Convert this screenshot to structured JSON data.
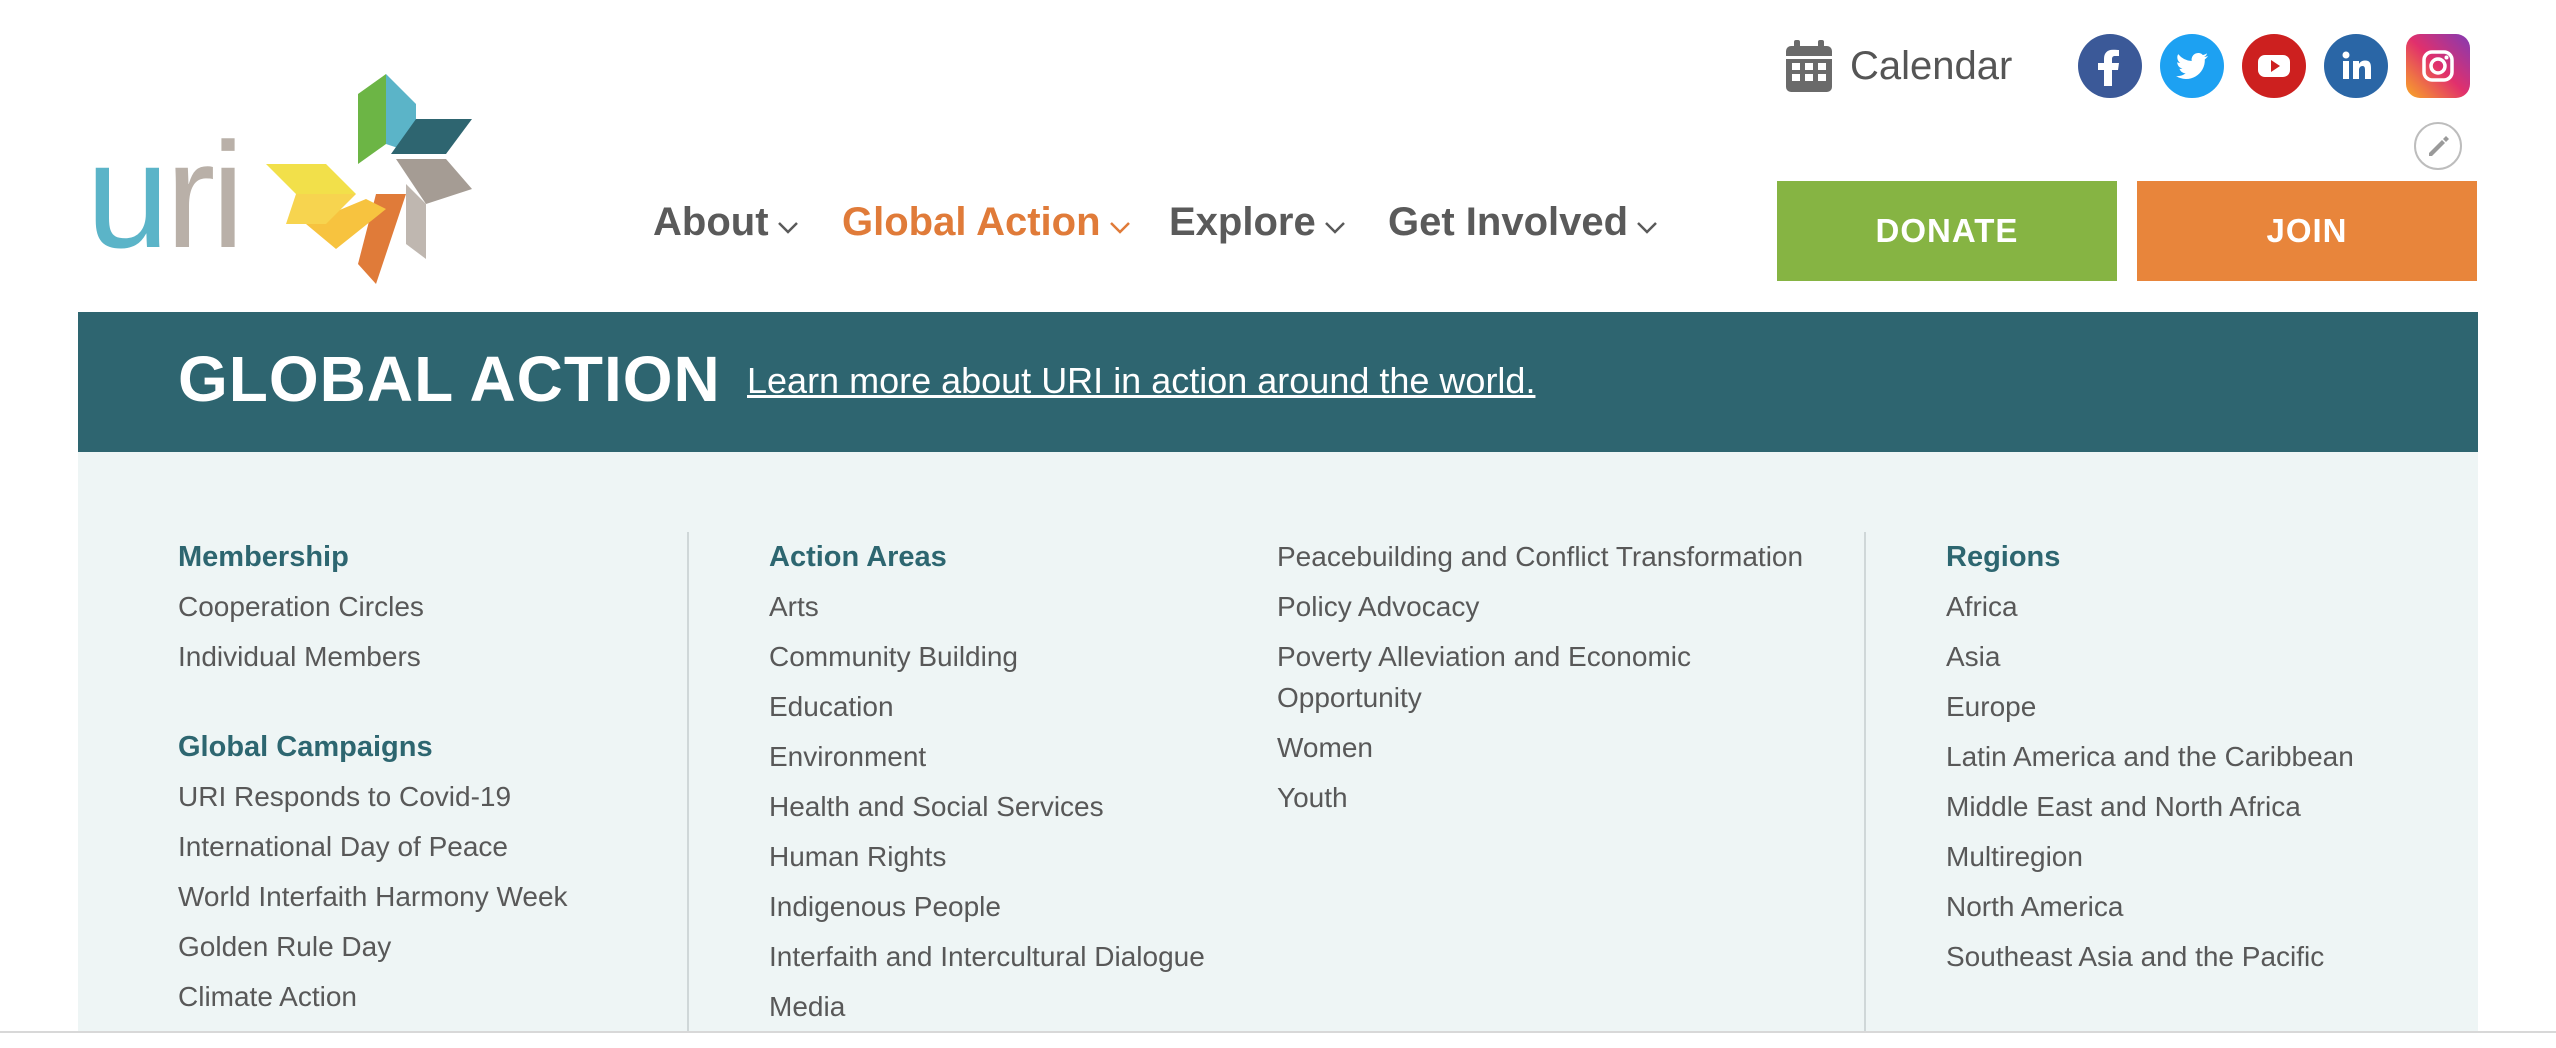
{
  "header": {
    "logo_text": "uri",
    "calendar_label": "Calendar",
    "social": [
      {
        "name": "facebook",
        "color": "#3b5998"
      },
      {
        "name": "twitter",
        "color": "#1da1f2"
      },
      {
        "name": "youtube",
        "color": "#cd201f"
      },
      {
        "name": "linkedin",
        "color": "#2a66a6"
      },
      {
        "name": "instagram",
        "color": "#e1306c"
      }
    ]
  },
  "nav": {
    "about": "About",
    "global_action": "Global Action",
    "explore": "Explore",
    "get_involved": "Get Involved"
  },
  "buttons": {
    "donate": "DONATE",
    "join": "JOIN"
  },
  "mega_menu": {
    "title": "GLOBAL ACTION",
    "link": "Learn more about URI in action around the world.",
    "membership": {
      "heading": "Membership",
      "items": [
        "Cooperation Circles",
        "Individual Members"
      ]
    },
    "campaigns": {
      "heading": "Global Campaigns",
      "items": [
        "URI Responds to Covid-19",
        "International Day of Peace",
        "World Interfaith Harmony Week",
        "Golden Rule Day",
        "Climate Action"
      ]
    },
    "action_areas": {
      "heading": "Action Areas",
      "items": [
        "Arts",
        "Community Building",
        "Education",
        "Environment",
        "Health and Social Services",
        "Human Rights",
        "Indigenous People",
        "Interfaith and Intercultural Dialogue",
        "Media"
      ],
      "items_col2": [
        "Peacebuilding and Conflict Transformation",
        "Policy Advocacy",
        "Poverty Alleviation and Economic Opportunity",
        "Women",
        "Youth"
      ]
    },
    "regions": {
      "heading": "Regions",
      "items": [
        "Africa",
        "Asia",
        "Europe",
        "Latin America and the Caribbean",
        "Middle East and North Africa",
        "Multiregion",
        "North America",
        "Southeast Asia and the Pacific"
      ]
    }
  },
  "colors": {
    "accent_orange": "#e07b39",
    "teal_dark": "#2e6570",
    "donate_green": "#86b443",
    "join_orange": "#e8853b"
  }
}
